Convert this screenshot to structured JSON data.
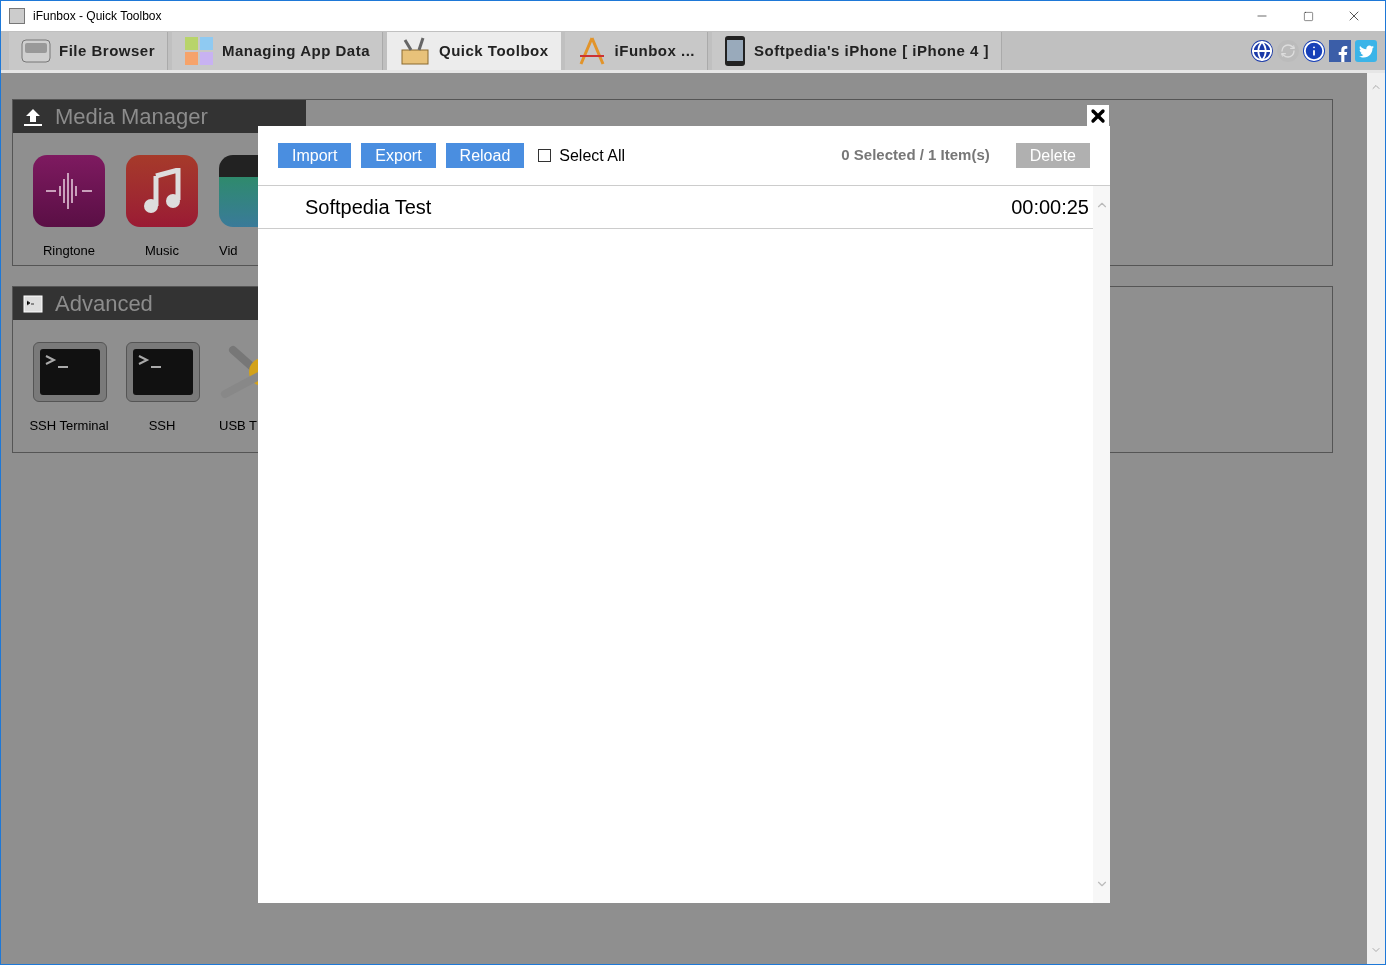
{
  "window": {
    "title": "iFunbox - Quick Toolbox"
  },
  "tabs": [
    {
      "label": "File Browser",
      "kind": "fun",
      "selected": false
    },
    {
      "label": "Managing App Data",
      "kind": "grid",
      "selected": false
    },
    {
      "label": "Quick Toolbox",
      "kind": "toolbox",
      "selected": true
    },
    {
      "label": "iFunbox ...",
      "kind": "compass",
      "selected": false
    },
    {
      "label": "Softpedia's iPhone [ iPhone 4 ]",
      "kind": "phone",
      "selected": false
    }
  ],
  "sections": [
    {
      "title": "Media Manager",
      "kind": "upload",
      "items": [
        {
          "label": "Ringtone",
          "kind": "ringtone"
        },
        {
          "label": "Music",
          "kind": "music"
        },
        {
          "label": "Vid",
          "kind": "video"
        }
      ]
    },
    {
      "title": "Advanced",
      "kind": "console",
      "items": [
        {
          "label": "SSH Terminal",
          "kind": "terminal"
        },
        {
          "label": "SSH",
          "kind": "terminal"
        },
        {
          "label": "USB T",
          "kind": "usb"
        }
      ]
    }
  ],
  "dialog": {
    "buttons": [
      "Import",
      "Export",
      "Reload"
    ],
    "select_all": {
      "label": "Select All",
      "checked": false
    },
    "status": "0 Selected / 1 Item(s)",
    "delete": {
      "label": "Delete",
      "disabled": true
    },
    "rows": [
      {
        "name": "Softpedia Test",
        "duration": "00:00:25"
      }
    ]
  }
}
